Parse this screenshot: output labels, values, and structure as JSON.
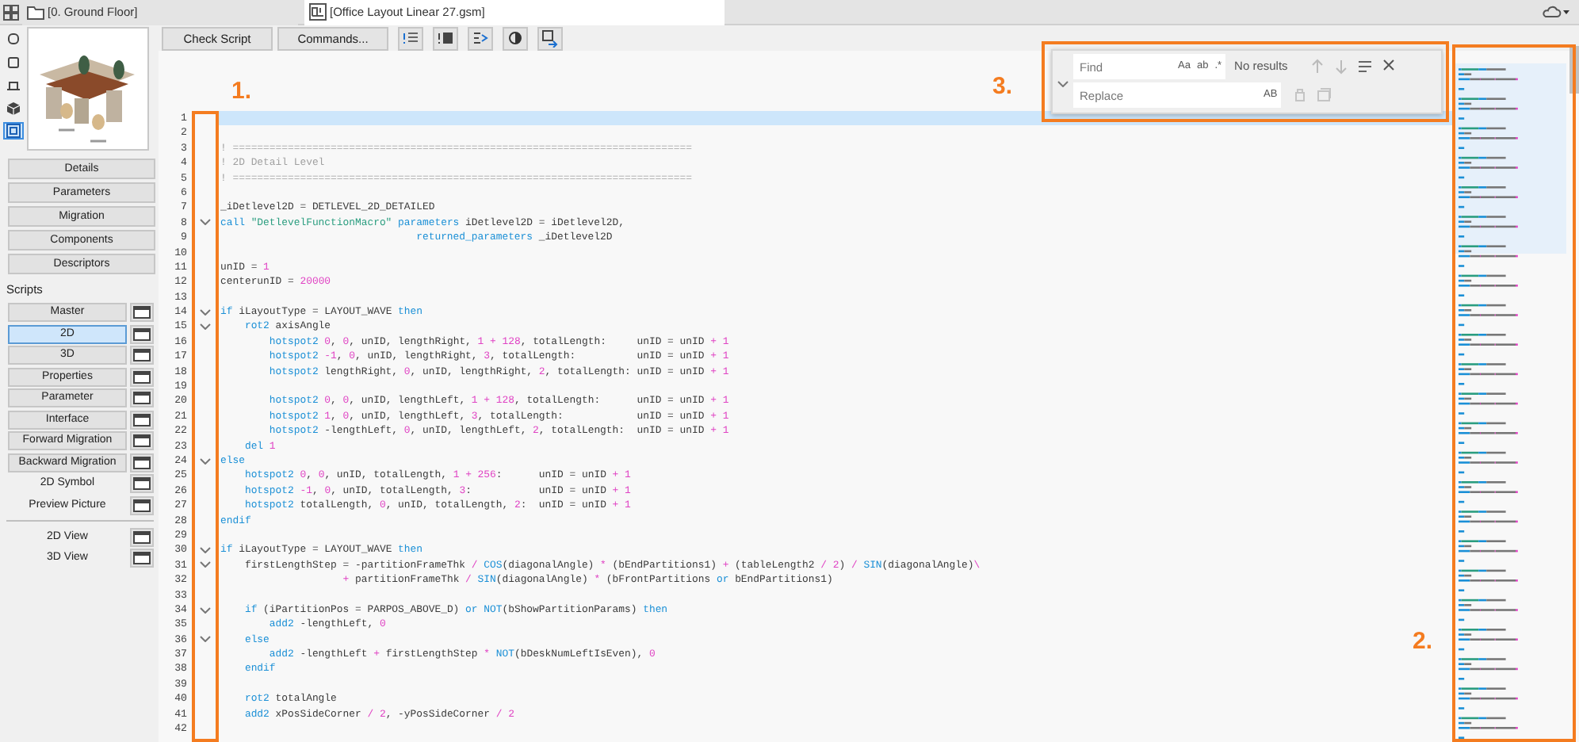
{
  "tabs": [
    {
      "label": "[0. Ground Floor]",
      "selected": false
    },
    {
      "label": "[Office Layout Linear 27.gsm]",
      "selected": true
    }
  ],
  "side_tools": [
    {
      "selected": false
    },
    {
      "selected": false
    },
    {
      "selected": false
    },
    {
      "selected": false
    },
    {
      "selected": true
    }
  ],
  "sections": [
    "Details",
    "Parameters",
    "Migration",
    "Components",
    "Descriptors"
  ],
  "scripts_label": "Scripts",
  "scripts": [
    {
      "label": "Master",
      "kind": "button",
      "selected": false
    },
    {
      "label": "2D",
      "kind": "button",
      "selected": true
    },
    {
      "label": "3D",
      "kind": "button",
      "selected": false
    },
    {
      "label": "Properties",
      "kind": "button",
      "selected": false
    },
    {
      "label": "Parameter",
      "kind": "button",
      "selected": false
    },
    {
      "label": "Interface",
      "kind": "button",
      "selected": false
    },
    {
      "label": "Forward Migration",
      "kind": "button",
      "selected": false
    },
    {
      "label": "Backward Migration",
      "kind": "button",
      "selected": false
    },
    {
      "label": "2D Symbol",
      "kind": "flat",
      "selected": false
    },
    {
      "label": "Preview Picture",
      "kind": "flat",
      "selected": false
    }
  ],
  "views": [
    "2D View",
    "3D View"
  ],
  "toolbar": {
    "buttons": [
      "Check Script",
      "Commands..."
    ]
  },
  "find": {
    "find_placeholder": "Find",
    "find_options": [
      "Aa",
      "ab",
      ".*"
    ],
    "status": "No results",
    "replace_placeholder": "Replace",
    "replace_options": [
      "AB"
    ]
  },
  "code": {
    "lines": [
      {
        "number": "1",
        "current": true,
        "fold": false
      },
      {
        "number": "2",
        "current": false,
        "fold": false
      },
      {
        "number": "3",
        "current": false,
        "fold": false,
        "tokens": [
          {
            "kind": "com",
            "t": "! ==========================================================================="
          }
        ]
      },
      {
        "number": "4",
        "current": false,
        "fold": false,
        "tokens": [
          {
            "kind": "com",
            "t": "! 2D Detail Level"
          }
        ]
      },
      {
        "number": "5",
        "current": false,
        "fold": false,
        "tokens": [
          {
            "kind": "com",
            "t": "! ==========================================================================="
          }
        ]
      },
      {
        "number": "6",
        "current": false,
        "fold": false
      },
      {
        "number": "7",
        "current": false,
        "fold": false,
        "tokens": [
          {
            "kind": "txt",
            "t": "_iDetlevel2D = DETLEVEL_2D_DETAILED"
          }
        ]
      },
      {
        "number": "8",
        "current": false,
        "fold": true,
        "tokens": [
          {
            "kind": "kw",
            "t": "call"
          },
          {
            "kind": "str",
            "t": " \"DetlevelFunctionMacro\""
          },
          {
            "kind": "kw",
            "t": " parameters"
          },
          {
            "kind": "txt",
            "t": " iDetlevel2D = iDetlevel2D,"
          }
        ]
      },
      {
        "number": "9",
        "current": false,
        "fold": false,
        "tokens": [
          {
            "kind": "kw",
            "t": "                                returned_parameters"
          },
          {
            "kind": "txt",
            "t": " _iDetlevel2D"
          }
        ]
      },
      {
        "number": "10",
        "current": false,
        "fold": false
      },
      {
        "number": "11",
        "current": false,
        "fold": false,
        "tokens": [
          {
            "kind": "txt",
            "t": "unID = "
          },
          {
            "kind": "lit",
            "t": "1"
          }
        ]
      },
      {
        "number": "12",
        "current": false,
        "fold": false,
        "tokens": [
          {
            "kind": "txt",
            "t": "centerunID = "
          },
          {
            "kind": "lit",
            "t": "20000"
          }
        ]
      },
      {
        "number": "13",
        "current": false,
        "fold": false
      },
      {
        "number": "14",
        "current": false,
        "fold": true,
        "tokens": [
          {
            "kind": "kw",
            "t": "if"
          },
          {
            "kind": "txt",
            "t": " iLayoutType = LAYOUT_WAVE "
          },
          {
            "kind": "kw",
            "t": "then"
          }
        ]
      },
      {
        "number": "15",
        "current": false,
        "fold": true,
        "tokens": [
          {
            "kind": "kw",
            "t": "    rot2"
          },
          {
            "kind": "txt",
            "t": " axisAngle"
          }
        ]
      },
      {
        "number": "16",
        "current": false,
        "fold": false,
        "tokens": [
          {
            "kind": "kw",
            "t": "        hotspot2"
          },
          {
            "kind": "lit",
            "t": " 0"
          },
          {
            "kind": "txt",
            "t": ", "
          },
          {
            "kind": "lit",
            "t": "0"
          },
          {
            "kind": "txt",
            "t": ", unID, lengthRight, "
          },
          {
            "kind": "lit",
            "t": "1 + 128"
          },
          {
            "kind": "txt",
            "t": ", totalLength:     unID = unID "
          },
          {
            "kind": "lit",
            "t": "+ 1"
          }
        ]
      },
      {
        "number": "17",
        "current": false,
        "fold": false,
        "tokens": [
          {
            "kind": "kw",
            "t": "        hotspot2"
          },
          {
            "kind": "lit",
            "t": " -1"
          },
          {
            "kind": "txt",
            "t": ", "
          },
          {
            "kind": "lit",
            "t": "0"
          },
          {
            "kind": "txt",
            "t": ", unID, lengthRight, "
          },
          {
            "kind": "lit",
            "t": "3"
          },
          {
            "kind": "txt",
            "t": ", totalLength:          unID = unID "
          },
          {
            "kind": "lit",
            "t": "+ 1"
          }
        ]
      },
      {
        "number": "18",
        "current": false,
        "fold": false,
        "tokens": [
          {
            "kind": "kw",
            "t": "        hotspot2"
          },
          {
            "kind": "txt",
            "t": " lengthRight, "
          },
          {
            "kind": "lit",
            "t": "0"
          },
          {
            "kind": "txt",
            "t": ", unID, lengthRight, "
          },
          {
            "kind": "lit",
            "t": "2"
          },
          {
            "kind": "txt",
            "t": ", totalLength: unID = unID "
          },
          {
            "kind": "lit",
            "t": "+ 1"
          }
        ]
      },
      {
        "number": "19",
        "current": false,
        "fold": false
      },
      {
        "number": "20",
        "current": false,
        "fold": false,
        "tokens": [
          {
            "kind": "kw",
            "t": "        hotspot2"
          },
          {
            "kind": "lit",
            "t": " 0"
          },
          {
            "kind": "txt",
            "t": ", "
          },
          {
            "kind": "lit",
            "t": "0"
          },
          {
            "kind": "txt",
            "t": ", unID, lengthLeft, "
          },
          {
            "kind": "lit",
            "t": "1 + 128"
          },
          {
            "kind": "txt",
            "t": ", totalLength:      unID = unID "
          },
          {
            "kind": "lit",
            "t": "+ 1"
          }
        ]
      },
      {
        "number": "21",
        "current": false,
        "fold": false,
        "tokens": [
          {
            "kind": "kw",
            "t": "        hotspot2"
          },
          {
            "kind": "lit",
            "t": " 1"
          },
          {
            "kind": "txt",
            "t": ", "
          },
          {
            "kind": "lit",
            "t": "0"
          },
          {
            "kind": "txt",
            "t": ", unID, lengthLeft, "
          },
          {
            "kind": "lit",
            "t": "3"
          },
          {
            "kind": "txt",
            "t": ", totalLength:            unID = unID "
          },
          {
            "kind": "lit",
            "t": "+ 1"
          }
        ]
      },
      {
        "number": "22",
        "current": false,
        "fold": false,
        "tokens": [
          {
            "kind": "kw",
            "t": "        hotspot2"
          },
          {
            "kind": "txt",
            "t": " -lengthLeft, "
          },
          {
            "kind": "lit",
            "t": "0"
          },
          {
            "kind": "txt",
            "t": ", unID, lengthLeft, "
          },
          {
            "kind": "lit",
            "t": "2"
          },
          {
            "kind": "txt",
            "t": ", totalLength:  unID = unID "
          },
          {
            "kind": "lit",
            "t": "+ 1"
          }
        ]
      },
      {
        "number": "23",
        "current": false,
        "fold": false,
        "tokens": [
          {
            "kind": "kw",
            "t": "    del"
          },
          {
            "kind": "lit",
            "t": " 1"
          }
        ]
      },
      {
        "number": "24",
        "current": false,
        "fold": true,
        "tokens": [
          {
            "kind": "kw",
            "t": "else"
          }
        ]
      },
      {
        "number": "25",
        "current": false,
        "fold": false,
        "tokens": [
          {
            "kind": "kw",
            "t": "    hotspot2"
          },
          {
            "kind": "lit",
            "t": " 0"
          },
          {
            "kind": "txt",
            "t": ", "
          },
          {
            "kind": "lit",
            "t": "0"
          },
          {
            "kind": "txt",
            "t": ", unID, totalLength, "
          },
          {
            "kind": "lit",
            "t": "1 + 256"
          },
          {
            "kind": "txt",
            "t": ":      unID = unID "
          },
          {
            "kind": "lit",
            "t": "+ 1"
          }
        ]
      },
      {
        "number": "26",
        "current": false,
        "fold": false,
        "tokens": [
          {
            "kind": "kw",
            "t": "    hotspot2"
          },
          {
            "kind": "lit",
            "t": " -1"
          },
          {
            "kind": "txt",
            "t": ", "
          },
          {
            "kind": "lit",
            "t": "0"
          },
          {
            "kind": "txt",
            "t": ", unID, totalLength, "
          },
          {
            "kind": "lit",
            "t": "3"
          },
          {
            "kind": "txt",
            "t": ":           unID = unID "
          },
          {
            "kind": "lit",
            "t": "+ 1"
          }
        ]
      },
      {
        "number": "27",
        "current": false,
        "fold": false,
        "tokens": [
          {
            "kind": "kw",
            "t": "    hotspot2"
          },
          {
            "kind": "txt",
            "t": " totalLength, "
          },
          {
            "kind": "lit",
            "t": "0"
          },
          {
            "kind": "txt",
            "t": ", unID, totalLength, "
          },
          {
            "kind": "lit",
            "t": "2"
          },
          {
            "kind": "txt",
            "t": ":  unID = unID "
          },
          {
            "kind": "lit",
            "t": "+ 1"
          }
        ]
      },
      {
        "number": "28",
        "current": false,
        "fold": false,
        "tokens": [
          {
            "kind": "kw",
            "t": "endif"
          }
        ]
      },
      {
        "number": "29",
        "current": false,
        "fold": false
      },
      {
        "number": "30",
        "current": false,
        "fold": true,
        "tokens": [
          {
            "kind": "kw",
            "t": "if"
          },
          {
            "kind": "txt",
            "t": " iLayoutType = LAYOUT_WAVE "
          },
          {
            "kind": "kw",
            "t": "then"
          }
        ]
      },
      {
        "number": "31",
        "current": false,
        "fold": true,
        "tokens": [
          {
            "kind": "txt",
            "t": "    firstLengthStep = -partitionFrameThk "
          },
          {
            "kind": "lit",
            "t": "/"
          },
          {
            "kind": "kw",
            "t": " COS"
          },
          {
            "kind": "txt",
            "t": "(diagonalAngle) "
          },
          {
            "kind": "lit",
            "t": "*"
          },
          {
            "kind": "txt",
            "t": " (bEndPartitions1) "
          },
          {
            "kind": "lit",
            "t": "+"
          },
          {
            "kind": "txt",
            "t": " (tableLength2 "
          },
          {
            "kind": "lit",
            "t": "/ 2"
          },
          {
            "kind": "txt",
            "t": ") "
          },
          {
            "kind": "lit",
            "t": "/"
          },
          {
            "kind": "kw",
            "t": " SIN"
          },
          {
            "kind": "txt",
            "t": "(diagonalAngle)"
          },
          {
            "kind": "lit",
            "t": "\\"
          }
        ]
      },
      {
        "number": "32",
        "current": false,
        "fold": false,
        "tokens": [
          {
            "kind": "lit",
            "t": "                    +"
          },
          {
            "kind": "txt",
            "t": " partitionFrameThk "
          },
          {
            "kind": "lit",
            "t": "/"
          },
          {
            "kind": "kw",
            "t": " SIN"
          },
          {
            "kind": "txt",
            "t": "(diagonalAngle) "
          },
          {
            "kind": "lit",
            "t": "*"
          },
          {
            "kind": "txt",
            "t": " (bFrontPartitions "
          },
          {
            "kind": "kw",
            "t": "or"
          },
          {
            "kind": "txt",
            "t": " bEndPartitions1)"
          }
        ]
      },
      {
        "number": "33",
        "current": false,
        "fold": false
      },
      {
        "number": "34",
        "current": false,
        "fold": true,
        "tokens": [
          {
            "kind": "kw",
            "t": "    if"
          },
          {
            "kind": "txt",
            "t": " (iPartitionPos = PARPOS_ABOVE_D) "
          },
          {
            "kind": "kw",
            "t": "or NOT"
          },
          {
            "kind": "txt",
            "t": "(bShowPartitionParams) "
          },
          {
            "kind": "kw",
            "t": "then"
          }
        ]
      },
      {
        "number": "35",
        "current": false,
        "fold": false,
        "tokens": [
          {
            "kind": "kw",
            "t": "        add2"
          },
          {
            "kind": "txt",
            "t": " -lengthLeft, "
          },
          {
            "kind": "lit",
            "t": "0"
          }
        ]
      },
      {
        "number": "36",
        "current": false,
        "fold": true,
        "tokens": [
          {
            "kind": "kw",
            "t": "    else"
          }
        ]
      },
      {
        "number": "37",
        "current": false,
        "fold": false,
        "tokens": [
          {
            "kind": "kw",
            "t": "        add2"
          },
          {
            "kind": "txt",
            "t": " -lengthLeft "
          },
          {
            "kind": "lit",
            "t": "+"
          },
          {
            "kind": "txt",
            "t": " firstLengthStep "
          },
          {
            "kind": "lit",
            "t": "*"
          },
          {
            "kind": "kw",
            "t": " NOT"
          },
          {
            "kind": "txt",
            "t": "(bDeskNumLeftIsEven), "
          },
          {
            "kind": "lit",
            "t": "0"
          }
        ]
      },
      {
        "number": "38",
        "current": false,
        "fold": false,
        "tokens": [
          {
            "kind": "kw",
            "t": "    endif"
          }
        ]
      },
      {
        "number": "39",
        "current": false,
        "fold": false
      },
      {
        "number": "40",
        "current": false,
        "fold": false,
        "tokens": [
          {
            "kind": "kw",
            "t": "    rot2"
          },
          {
            "kind": "txt",
            "t": " totalAngle"
          }
        ]
      },
      {
        "number": "41",
        "current": false,
        "fold": false,
        "tokens": [
          {
            "kind": "kw",
            "t": "    add2"
          },
          {
            "kind": "txt",
            "t": " xPosSideCorner "
          },
          {
            "kind": "lit",
            "t": "/ 2"
          },
          {
            "kind": "txt",
            "t": ", -yPosSideCorner "
          },
          {
            "kind": "lit",
            "t": "/ 2"
          }
        ]
      },
      {
        "number": "42",
        "current": false,
        "fold": false
      }
    ]
  },
  "annotations": [
    {
      "label": "1."
    },
    {
      "label": "2."
    },
    {
      "label": "3."
    }
  ]
}
